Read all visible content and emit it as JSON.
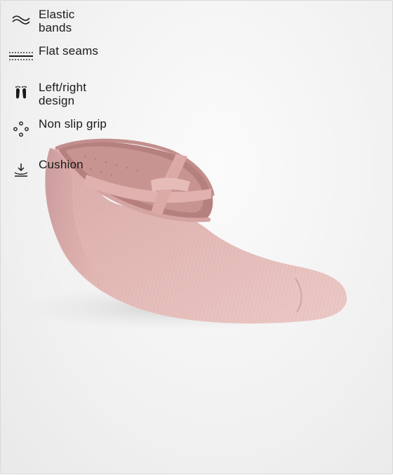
{
  "features": [
    {
      "icon": "elastic-bands-icon",
      "label": "Elastic bands"
    },
    {
      "icon": "flat-seams-icon",
      "label": "Flat seams"
    },
    {
      "icon": "left-right-feet-icon",
      "label": "Left/right design"
    },
    {
      "icon": "non-slip-dots-icon",
      "label": "Non slip grip"
    },
    {
      "icon": "cushion-icon",
      "label": "Cushion"
    }
  ],
  "product": {
    "image": "pink-yoga-sock-image",
    "colors": {
      "sock": "#dcaeab",
      "sock_shadow": "#c38f8d",
      "band": "#e2b2b0",
      "inner": "#b98482"
    }
  }
}
